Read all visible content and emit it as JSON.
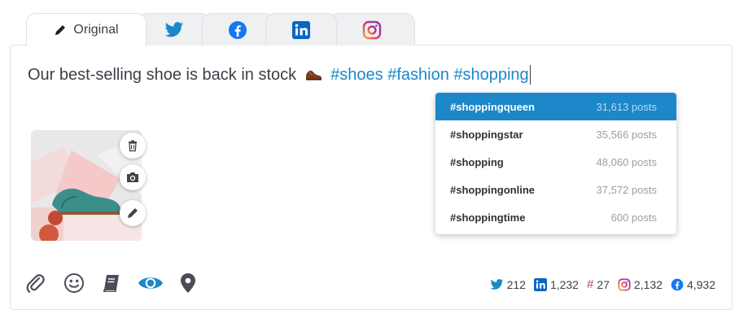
{
  "tabs": [
    {
      "label": "Original",
      "icon": "pencil-icon"
    },
    {
      "label": "",
      "icon": "twitter-icon"
    },
    {
      "label": "",
      "icon": "facebook-icon"
    },
    {
      "label": "",
      "icon": "linkedin-icon"
    },
    {
      "label": "",
      "icon": "instagram-icon"
    }
  ],
  "post": {
    "text": "Our best-selling shoe is back in stock",
    "emoji": "shoe-emoji",
    "hashtags": "#shoes #fashion #shopping"
  },
  "suggestions": [
    {
      "tag": "#shoppingqueen",
      "count": "31,613 posts",
      "selected": true
    },
    {
      "tag": "#shoppingstar",
      "count": "35,566 posts",
      "selected": false
    },
    {
      "tag": "#shopping",
      "count": "48,060 posts",
      "selected": false
    },
    {
      "tag": "#shoppingonline",
      "count": "37,572 posts",
      "selected": false
    },
    {
      "tag": "#shoppingtime",
      "count": "600 posts",
      "selected": false
    }
  ],
  "image_actions": [
    "trash-icon",
    "camera-icon",
    "pencil-icon"
  ],
  "toolbar": [
    "paperclip-icon",
    "emoji-icon",
    "book-icon",
    "eye-icon",
    "location-pin-icon"
  ],
  "stats": [
    {
      "icon": "twitter-icon",
      "value": "212"
    },
    {
      "icon": "linkedin-icon",
      "value": "1,232"
    },
    {
      "icon": "hashtag-icon",
      "value": "27"
    },
    {
      "icon": "instagram-icon",
      "value": "2,132"
    },
    {
      "icon": "facebook-icon",
      "value": "4,932"
    }
  ],
  "colors": {
    "accent": "#1c87c9",
    "hashtag": "#b23a8c",
    "linkedin": "#0a66c2",
    "facebook": "#1877f2"
  }
}
